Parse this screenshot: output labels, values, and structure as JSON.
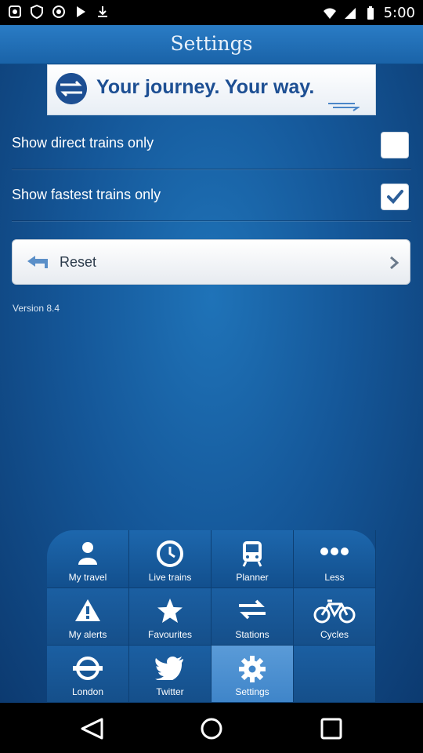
{
  "status_bar": {
    "time": "5:00"
  },
  "header": {
    "title": "Settings"
  },
  "banner": {
    "text": "Your journey. Your way."
  },
  "settings": {
    "direct_trains": {
      "label": "Show direct trains only",
      "checked": false
    },
    "fastest_trains": {
      "label": "Show fastest trains only",
      "checked": true
    },
    "reset_label": "Reset",
    "version": "Version 8.4"
  },
  "tabs": [
    {
      "label": "My travel",
      "icon": "person-icon"
    },
    {
      "label": "Live trains",
      "icon": "clock-icon"
    },
    {
      "label": "Planner",
      "icon": "train-icon"
    },
    {
      "label": "Less",
      "icon": "more-dots-icon"
    },
    {
      "label": "My alerts",
      "icon": "alert-icon"
    },
    {
      "label": "Favourites",
      "icon": "star-icon"
    },
    {
      "label": "Stations",
      "icon": "stations-icon"
    },
    {
      "label": "Cycles",
      "icon": "bicycle-icon"
    },
    {
      "label": "London",
      "icon": "london-icon"
    },
    {
      "label": "Twitter",
      "icon": "twitter-icon"
    },
    {
      "label": "Settings",
      "icon": "gear-icon"
    }
  ],
  "colors": {
    "accent": "#1a63a8",
    "active_tab": "#4a8fd0",
    "banner_text": "#1d4f93"
  }
}
